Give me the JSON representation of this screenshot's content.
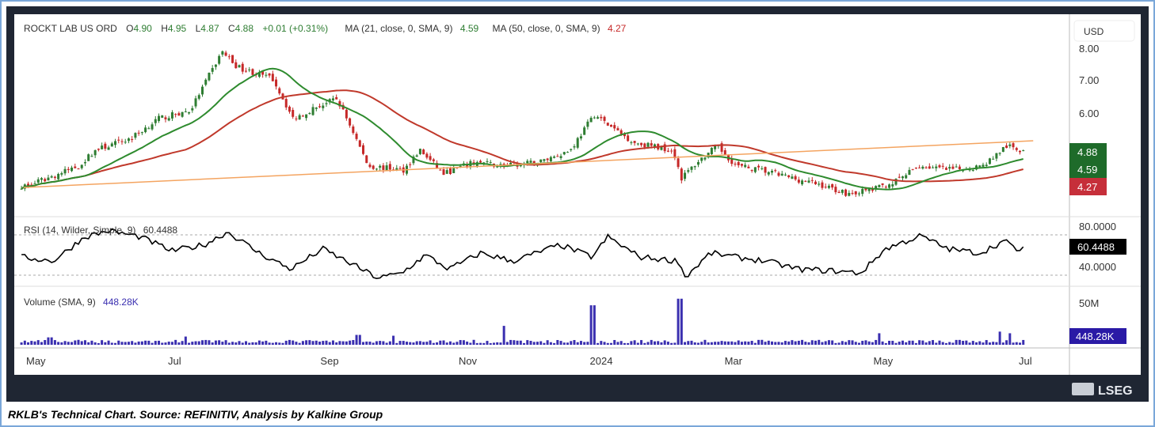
{
  "legend": {
    "name": "ROCKT LAB US ORD",
    "o_label": "O",
    "o": "4.90",
    "h_label": "H",
    "h": "4.95",
    "l_label": "L",
    "l": "4.87",
    "c_label": "C",
    "c": "4.88",
    "change": "+0.01 (+0.31%)",
    "ma21_label": "MA (21, close, 0, SMA, 9)",
    "ma21": "4.59",
    "ma50_label": "MA (50, close, 0, SMA, 9)",
    "ma50": "4.27",
    "rsi_label": "RSI (14, Wilder, Simple, 9)",
    "rsi": "60.4488",
    "vol_label": "Volume (SMA, 9)",
    "vol": "448.28K"
  },
  "currency": "USD",
  "brand": "LSEG",
  "caption": "RKLB's Technical Chart. Source: REFINITIV, Analysis by Kalkine Group",
  "colors": {
    "up": "#2e7d32",
    "down": "#c62828",
    "ma21": "#2e8b2e",
    "ma50": "#c0392b",
    "trend": "#f4a460",
    "volume": "#3a2fb0",
    "rsi": "#000000",
    "frame": "#1f2633"
  },
  "chart_data": {
    "type": "candlestick",
    "x_unit": "months since May 2023",
    "x_ticks": [
      {
        "m": 0,
        "label": "May"
      },
      {
        "m": 2,
        "label": "Jul"
      },
      {
        "m": 4.15,
        "label": "Sep"
      },
      {
        "m": 6.1,
        "label": "Nov"
      },
      {
        "m": 7.95,
        "label": "2024"
      },
      {
        "m": 9.85,
        "label": "Mar"
      },
      {
        "m": 11.95,
        "label": "May"
      },
      {
        "m": 14,
        "label": "Jul"
      }
    ],
    "price": {
      "y_ticks": [
        "8.00",
        "7.00",
        "6.00"
      ],
      "ylim": [
        3.3,
        8.2
      ],
      "close_keypoints": [
        [
          -0.11,
          3.78
        ],
        [
          0.61,
          4.39
        ],
        [
          0.84,
          4.88
        ],
        [
          1.34,
          5.24
        ],
        [
          1.73,
          5.85
        ],
        [
          2.18,
          6.1
        ],
        [
          2.63,
          7.93
        ],
        [
          2.85,
          7.44
        ],
        [
          3.35,
          7.07
        ],
        [
          3.63,
          5.85
        ],
        [
          3.97,
          6.22
        ],
        [
          4.25,
          6.46
        ],
        [
          4.47,
          5.49
        ],
        [
          4.69,
          4.39
        ],
        [
          5.19,
          4.27
        ],
        [
          5.42,
          4.88
        ],
        [
          5.75,
          4.15
        ],
        [
          6.2,
          4.51
        ],
        [
          6.65,
          4.39
        ],
        [
          7.09,
          4.51
        ],
        [
          7.54,
          4.88
        ],
        [
          7.88,
          5.98
        ],
        [
          8.1,
          5.61
        ],
        [
          8.44,
          5.12
        ],
        [
          8.99,
          4.88
        ],
        [
          9.11,
          4.02
        ],
        [
          9.33,
          4.51
        ],
        [
          9.61,
          5.0
        ],
        [
          9.89,
          4.39
        ],
        [
          10.22,
          4.27
        ],
        [
          10.67,
          4.02
        ],
        [
          11.12,
          3.78
        ],
        [
          11.45,
          3.54
        ],
        [
          11.79,
          3.66
        ],
        [
          12.12,
          3.9
        ],
        [
          12.46,
          4.39
        ],
        [
          12.91,
          4.27
        ],
        [
          13.35,
          4.39
        ],
        [
          13.69,
          5.0
        ],
        [
          13.91,
          4.88
        ]
      ],
      "trendline": [
        [
          -0.17,
          3.73
        ],
        [
          14.07,
          5.17
        ]
      ],
      "last_labels": {
        "close": "4.88",
        "ma21": "4.59",
        "ma50": "4.27"
      }
    },
    "rsi": {
      "y_ticks": [
        "80.0000",
        "40.0000"
      ],
      "ylim": [
        30,
        90
      ],
      "keypoints": [
        [
          -0.28,
          58
        ],
        [
          0.17,
          54
        ],
        [
          0.61,
          78
        ],
        [
          0.95,
          84
        ],
        [
          1.4,
          78
        ],
        [
          1.84,
          64
        ],
        [
          2.29,
          70
        ],
        [
          2.63,
          83
        ],
        [
          3.07,
          62
        ],
        [
          3.52,
          46
        ],
        [
          3.97,
          66
        ],
        [
          4.3,
          54
        ],
        [
          4.75,
          37
        ],
        [
          5.08,
          42
        ],
        [
          5.42,
          60
        ],
        [
          5.75,
          46
        ],
        [
          6.2,
          62
        ],
        [
          6.65,
          54
        ],
        [
          7.32,
          70
        ],
        [
          7.77,
          58
        ],
        [
          7.99,
          78
        ],
        [
          8.44,
          58
        ],
        [
          8.99,
          54
        ],
        [
          9.08,
          38
        ],
        [
          9.44,
          62
        ],
        [
          9.78,
          58
        ],
        [
          10.22,
          54
        ],
        [
          10.67,
          46
        ],
        [
          11.23,
          44
        ],
        [
          11.56,
          42
        ],
        [
          11.9,
          66
        ],
        [
          12.4,
          79
        ],
        [
          12.79,
          66
        ],
        [
          13.24,
          62
        ],
        [
          13.58,
          74
        ],
        [
          13.8,
          64
        ],
        [
          13.91,
          68
        ]
      ],
      "last": "60.4488"
    },
    "volume": {
      "y_ticks": [
        "50M"
      ],
      "ymax_millions": 62,
      "base_millions": 4,
      "spikes": [
        [
          6.6,
          23
        ],
        [
          7.86,
          48
        ],
        [
          9.08,
          56
        ],
        [
          0.2,
          9
        ],
        [
          2.1,
          10
        ],
        [
          4.55,
          12
        ],
        [
          5.05,
          11
        ],
        [
          11.9,
          14
        ],
        [
          13.6,
          16
        ],
        [
          13.75,
          14
        ]
      ],
      "last": "448.28K"
    }
  }
}
